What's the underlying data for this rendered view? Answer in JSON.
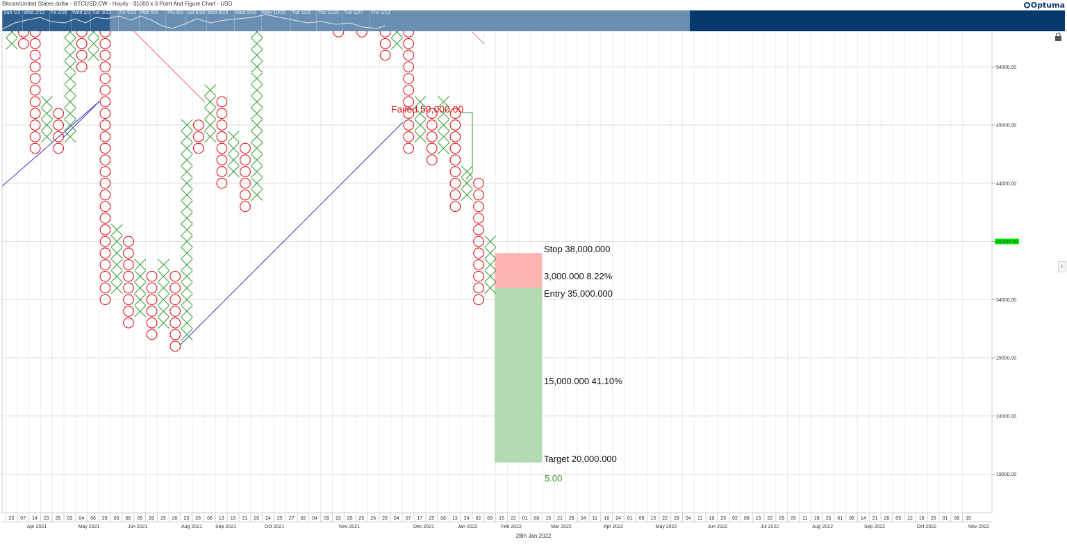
{
  "header": {
    "title": "Bitcoin/United States dollar - BTCUSD:CW - Hourly - $1000 x 3 Point And Figure Chart - USD",
    "logo_text": "Optuma"
  },
  "navigator": {
    "dates": [
      "Sun 1/3",
      "Wed 2/10",
      "Fri 2/26",
      "Wed 3/3",
      "Tue 3/23",
      "Fri 4/23",
      "Mon 5/3",
      "Thu 6/3",
      "Sat 6/26",
      "Mon 8/23",
      "Wed 9/16",
      "Mon 10/25",
      "Tue 11/9",
      "Thu 11/25",
      "Tue 12/7",
      "Thu 1/13"
    ]
  },
  "footer": {
    "date": "28th Jan 2022"
  },
  "colors": {
    "x_box": "#2e9b2e",
    "o_box": "#e0141a",
    "support_line": "#3b3bd1",
    "resistance_line": "#f07070",
    "stop_zone": "#ffb3b3",
    "target_zone": "#b3d9b0",
    "current_price_bg": "#00ee00"
  },
  "chart_data": {
    "type": "point-and-figure",
    "box_size": 1000,
    "reversal": 3,
    "ylim": [
      15000,
      59000
    ],
    "y_ticks": [
      "19000.00",
      "24000.00",
      "29000.00",
      "34000.00",
      "39000.00",
      "44000.00",
      "49000.00",
      "54000.00"
    ],
    "current_price": "39,000.00",
    "columns": [
      {
        "i": 0,
        "type": "X",
        "low": 56,
        "high": 57
      },
      {
        "i": 1,
        "type": "O",
        "low": 56,
        "high": 57
      },
      {
        "i": 2,
        "type": "O",
        "low": 47,
        "high": 57
      },
      {
        "i": 3,
        "type": "X",
        "low": 48,
        "high": 51
      },
      {
        "i": 4,
        "type": "O",
        "low": 47,
        "high": 50
      },
      {
        "i": 5,
        "type": "X",
        "low": 48,
        "high": 57
      },
      {
        "i": 6,
        "type": "O",
        "low": 54,
        "high": 57
      },
      {
        "i": 7,
        "type": "X",
        "low": 55,
        "high": 57
      },
      {
        "i": 8,
        "type": "O",
        "low": 34,
        "high": 57
      },
      {
        "i": 9,
        "type": "X",
        "low": 35,
        "high": 40
      },
      {
        "i": 10,
        "type": "O",
        "low": 32,
        "high": 39
      },
      {
        "i": 11,
        "type": "X",
        "low": 33,
        "high": 37
      },
      {
        "i": 12,
        "type": "O",
        "low": 31,
        "high": 36
      },
      {
        "i": 13,
        "type": "X",
        "low": 32,
        "high": 37
      },
      {
        "i": 14,
        "type": "O",
        "low": 30,
        "high": 36
      },
      {
        "i": 15,
        "type": "X",
        "low": 31,
        "high": 49
      },
      {
        "i": 16,
        "type": "O",
        "low": 47,
        "high": 49
      },
      {
        "i": 17,
        "type": "X",
        "low": 48,
        "high": 52
      },
      {
        "i": 18,
        "type": "O",
        "low": 44,
        "high": 51
      },
      {
        "i": 19,
        "type": "X",
        "low": 45,
        "high": 48
      },
      {
        "i": 20,
        "type": "O",
        "low": 42,
        "high": 47
      },
      {
        "i": 21,
        "type": "X",
        "low": 43,
        "high": 57
      },
      {
        "i": 28,
        "type": "O",
        "low": 57,
        "high": 57
      },
      {
        "i": 30,
        "type": "O",
        "low": 57,
        "high": 57
      },
      {
        "i": 32,
        "type": "O",
        "low": 55,
        "high": 57
      },
      {
        "i": 33,
        "type": "X",
        "low": 56,
        "high": 57
      },
      {
        "i": 34,
        "type": "O",
        "low": 47,
        "high": 57
      },
      {
        "i": 35,
        "type": "X",
        "low": 48,
        "high": 51
      },
      {
        "i": 36,
        "type": "O",
        "low": 46,
        "high": 50
      },
      {
        "i": 37,
        "type": "X",
        "low": 47,
        "high": 51
      },
      {
        "i": 38,
        "type": "O",
        "low": 42,
        "high": 50
      },
      {
        "i": 39,
        "type": "X",
        "low": 43,
        "high": 45
      },
      {
        "i": 40,
        "type": "O",
        "low": 34,
        "high": 44
      },
      {
        "i": 41,
        "type": "X",
        "low": 35,
        "high": 39
      }
    ],
    "x_ticks": [
      "23",
      "07",
      "14",
      "23",
      "25",
      "03",
      "04",
      "06",
      "29",
      "03",
      "08",
      "09",
      "26",
      "29",
      "20",
      "23",
      "26",
      "06",
      "13",
      "15",
      "21",
      "20",
      "24",
      "25",
      "27",
      "02",
      "04",
      "09",
      "19",
      "20",
      "25",
      "26",
      "29",
      "04",
      "07",
      "17",
      "25",
      "08",
      "13",
      "24",
      "02",
      "09",
      "15",
      "22",
      "01",
      "08",
      "15",
      "21",
      "28",
      "04",
      "11",
      "18",
      "24",
      "01",
      "08",
      "15",
      "22",
      "28",
      "04",
      "11",
      "18",
      "25",
      "02",
      "08",
      "15",
      "22",
      "29",
      "05",
      "11",
      "18",
      "25",
      "01",
      "08",
      "14",
      "21",
      "28",
      "05",
      "12",
      "18",
      "25",
      "01",
      "08",
      "15"
    ],
    "month_labels": [
      "Apr 2021",
      "May 2021",
      "Jun 2021",
      "Aug 2021",
      "Sep 2021",
      "Oct 2021",
      "Nov 2021",
      "Dec 2021",
      "Jan 2022",
      "Feb 2022",
      "Mar 2022",
      "Apr 2022",
      "May 2022",
      "Jun 2022",
      "Jul 2022",
      "Aug 2022",
      "Sep 2022",
      "Oct 2022",
      "Nov 2022"
    ],
    "annotations": {
      "failed": "Failed 50,000.00",
      "stop": "Stop   38,000.000",
      "risk": "3,000.000   8.22%",
      "entry": "Entry   35,000.000",
      "reward": "15,000.000   41.10%",
      "target": "Target   20,000.000",
      "ratio": "5.00"
    },
    "trade": {
      "stop": 38000,
      "entry": 35000,
      "target": 20000
    }
  }
}
